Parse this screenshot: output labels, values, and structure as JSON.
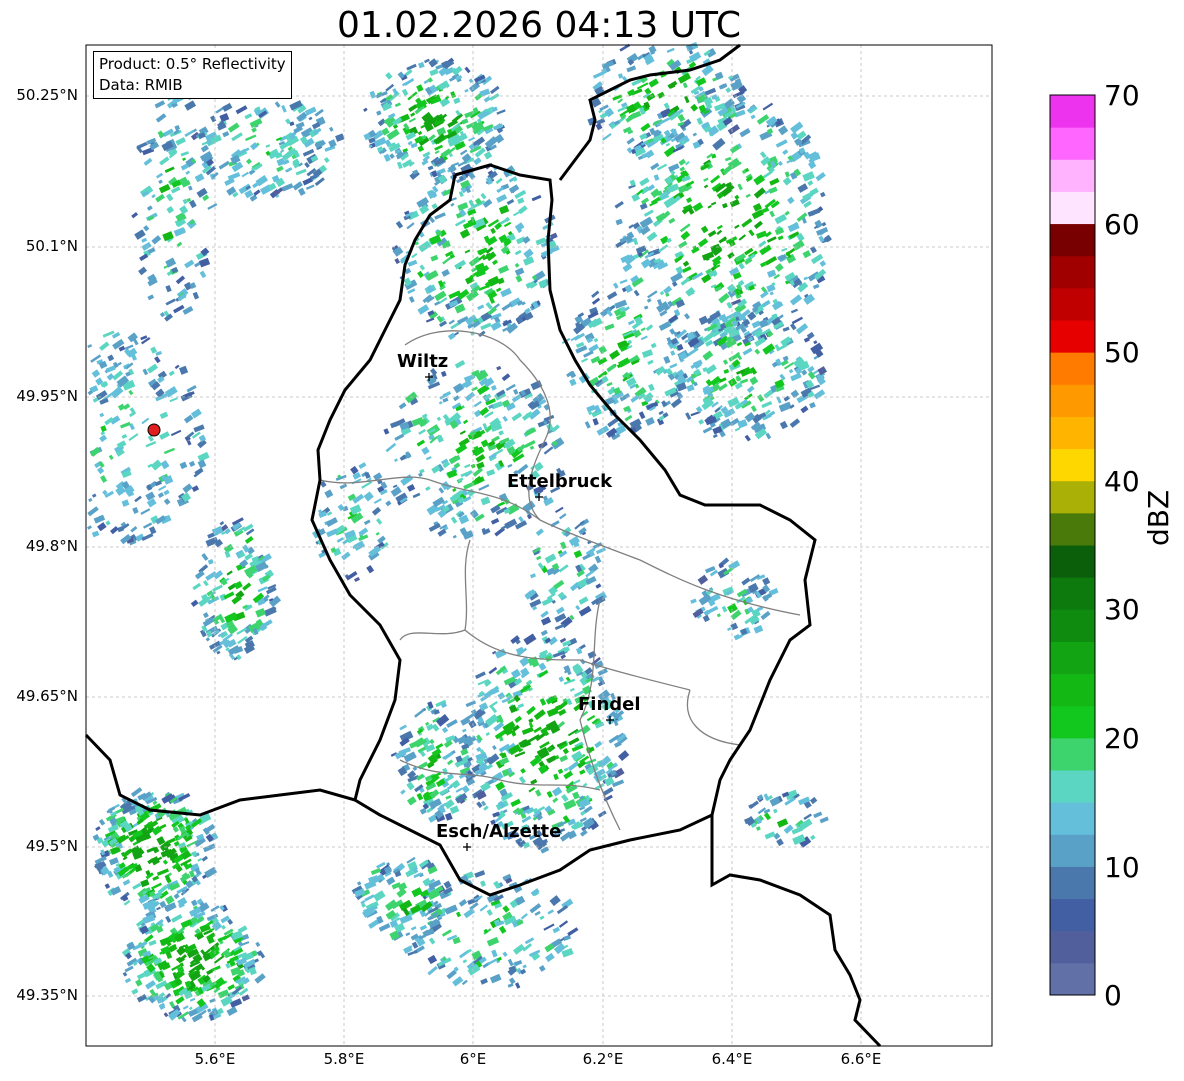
{
  "title": "01.02.2026 04:13 UTC",
  "info_box": {
    "product": "Product: 0.5° Reflectivity",
    "source": "Data: RMIB"
  },
  "lat_ticks": [
    "50.25°N",
    "50.1°N",
    "49.95°N",
    "49.8°N",
    "49.65°N",
    "49.5°N",
    "49.35°N"
  ],
  "lon_ticks": [
    "5.6°E",
    "5.8°E",
    "6°E",
    "6.2°E",
    "6.4°E",
    "6.6°E"
  ],
  "cities": [
    {
      "name": "Wiltz"
    },
    {
      "name": "Ettelbruck"
    },
    {
      "name": "Findel"
    },
    {
      "name": "Esch/Alzette"
    }
  ],
  "colorbar": {
    "unit": "dBZ",
    "ticks": [
      "70",
      "60",
      "50",
      "40",
      "30",
      "20",
      "10",
      "0"
    ],
    "range": [
      0,
      70
    ],
    "colors": [
      "#6171a8",
      "#515f9c",
      "#435fa4",
      "#4a78ad",
      "#5aa1c8",
      "#64bfdb",
      "#5bd6c2",
      "#3ed46d",
      "#12c81e",
      "#14b814",
      "#12a412",
      "#0f8c0f",
      "#0c7a0c",
      "#0b5f0b",
      "#4a7a0a",
      "#aab005",
      "#ffd700",
      "#ffb400",
      "#ff9900",
      "#ff7b00",
      "#e60000",
      "#c00000",
      "#a00000",
      "#780000",
      "#ffe4ff",
      "#ffb3ff",
      "#ff66ff",
      "#ee33ee"
    ]
  },
  "map_extent": {
    "lon": [
      5.4,
      6.8
    ],
    "lat": [
      49.3,
      50.3
    ]
  },
  "radar_site_color": "#e02020"
}
